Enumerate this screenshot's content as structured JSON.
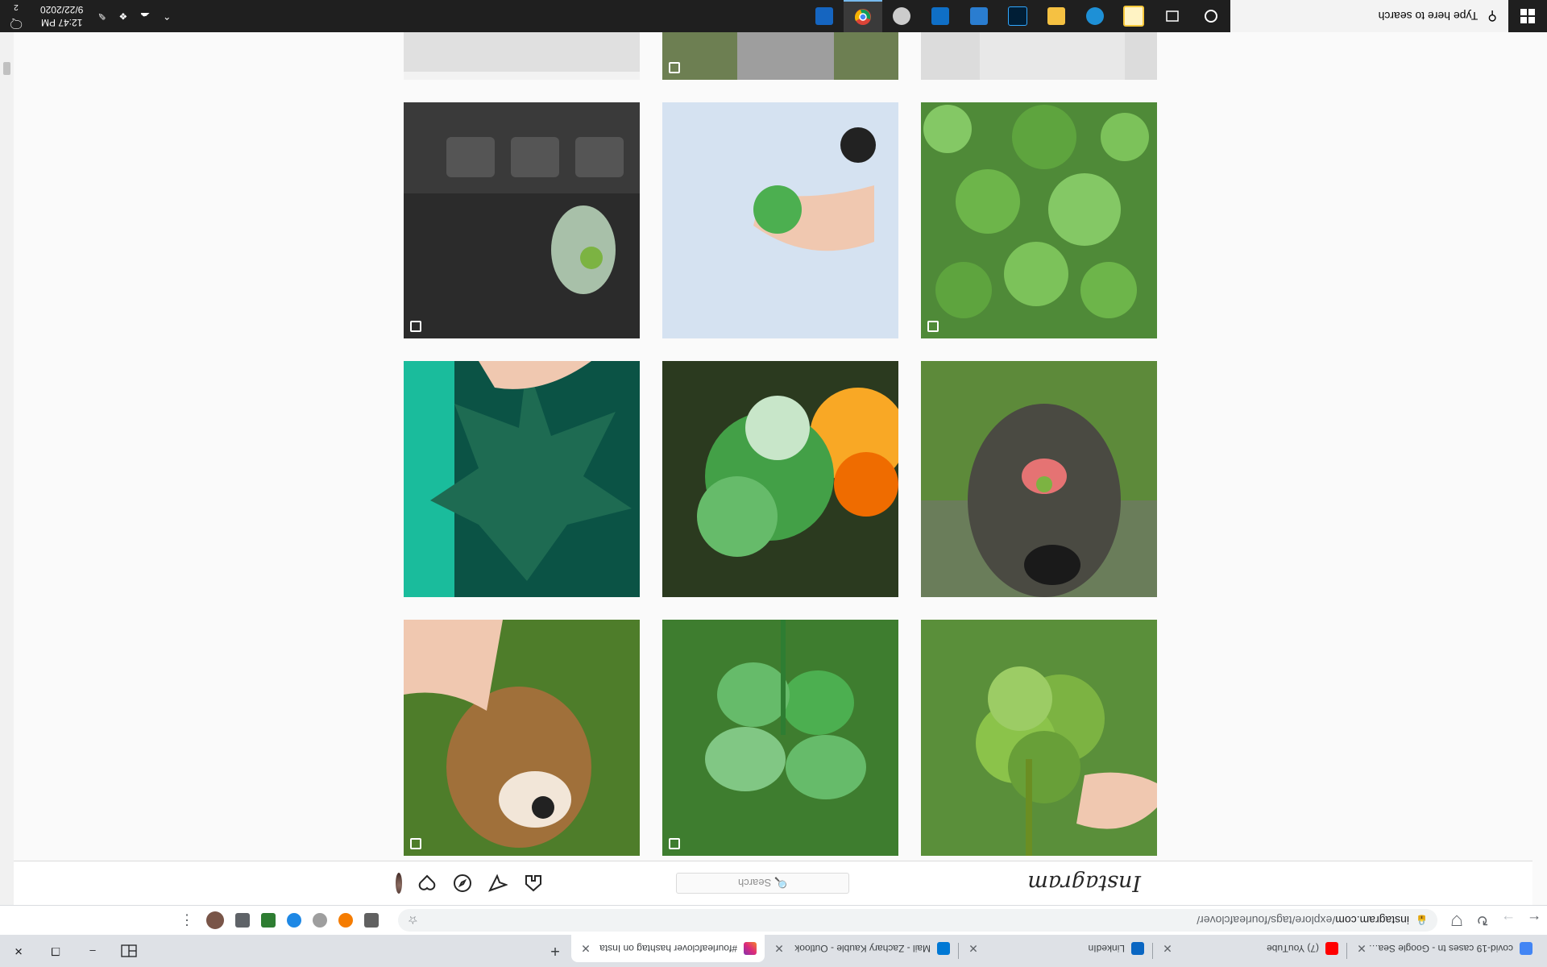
{
  "browser": {
    "tabs": [
      {
        "title": "covid-19 cases tn - Google Search",
        "favicon_color": "#4285f4",
        "active": false
      },
      {
        "title": "(7) YouTube",
        "favicon_color": "#ff0000",
        "active": false
      },
      {
        "title": "LinkedIn",
        "favicon_color": "#0a66c2",
        "active": false
      },
      {
        "title": "Mail - Zachary Kauble - Outlook",
        "favicon_color": "#0078d4",
        "active": false
      },
      {
        "title": "#fourleafclover hashtag on Insta",
        "favicon_color": "#c13584",
        "active": true
      }
    ],
    "new_tab_label": "+",
    "window_controls": {
      "minimize": "–",
      "maximize": "❐",
      "close": "✕"
    },
    "address_bar": {
      "url_host": "instagram.com",
      "url_path": "/explore/tags/fourleafclover/"
    }
  },
  "instagram": {
    "logo": "Instagram",
    "search_placeholder": "🔍 Search",
    "photos": [
      {
        "description": "clover",
        "bg": "#5a8f3a",
        "multi": false
      },
      {
        "description": "clover",
        "bg": "#6aa84f",
        "multi": true
      },
      {
        "description": "dog",
        "bg": "#a07850",
        "multi": true
      },
      {
        "description": "dog",
        "bg": "#4a5a3a",
        "multi": false
      },
      {
        "description": "clover",
        "bg": "#2e7d32",
        "multi": false
      },
      {
        "description": "leaf",
        "bg": "#1b5e4a",
        "multi": false
      },
      {
        "description": "clover",
        "bg": "#5c9e3c",
        "multi": true
      },
      {
        "description": "clover",
        "bg": "#b9c8dc",
        "multi": false
      },
      {
        "description": "keyboard",
        "bg": "#2b2b2b",
        "multi": true
      },
      {
        "description": "partial",
        "bg": "#dcdcdc",
        "multi": false
      },
      {
        "description": "partial",
        "bg": "#6d7f52",
        "multi": true
      },
      {
        "description": "partial",
        "bg": "#ececec",
        "multi": false
      }
    ]
  },
  "taskbar": {
    "search_placeholder": "Type here to search",
    "time": "12:47 PM",
    "date": "9/22/2020",
    "notification_count": "2",
    "apps": [
      {
        "name": "cortana",
        "color": "#ffffff"
      },
      {
        "name": "task-view",
        "color": "#ffffff"
      },
      {
        "name": "file-explorer",
        "color": "#f8c93c"
      },
      {
        "name": "edge",
        "color": "#1e90d6"
      },
      {
        "name": "folder",
        "color": "#f5c142"
      },
      {
        "name": "photoshop",
        "color": "#001e36"
      },
      {
        "name": "photos",
        "color": "#2a7dd0"
      },
      {
        "name": "outlook",
        "color": "#0f6fc6"
      },
      {
        "name": "settings",
        "color": "#cccccc"
      },
      {
        "name": "chrome",
        "color": "#4caf50"
      },
      {
        "name": "mail",
        "color": "#1565c0"
      }
    ]
  }
}
